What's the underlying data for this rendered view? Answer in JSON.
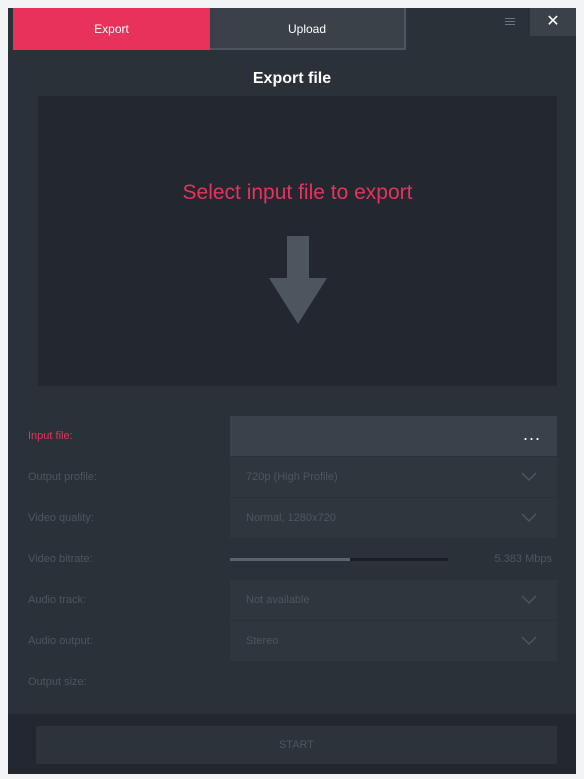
{
  "tabs": {
    "export": "Export",
    "upload": "Upload"
  },
  "window": {
    "close_glyph": "✕"
  },
  "title": "Export file",
  "drop": {
    "text": "Select input file to export"
  },
  "settings": {
    "input_file": {
      "label": "Input file:",
      "value": "",
      "browse": "..."
    },
    "output_profile": {
      "label": "Output profile:",
      "value": "720p (High Profile)"
    },
    "video_quality": {
      "label": "Video quality:",
      "value": "Normal, 1280x720"
    },
    "video_bitrate": {
      "label": "Video bitrate:",
      "value": "5.383 Mbps",
      "fill_fraction": 0.55
    },
    "audio_track": {
      "label": "Audio track:",
      "value": "Not available"
    },
    "audio_output": {
      "label": "Audio output:",
      "value": "Stereo"
    },
    "output_size": {
      "label": "Output size:",
      "value": ""
    }
  },
  "footer": {
    "start": "START"
  },
  "colors": {
    "accent": "#e8315b",
    "background": "#2b3138",
    "panel_dark": "#232830",
    "muted_text": "#4d555e"
  },
  "icons": [
    "minimize-icon",
    "close-icon",
    "down-arrow-icon",
    "chevron-down-icon",
    "more-icon"
  ]
}
